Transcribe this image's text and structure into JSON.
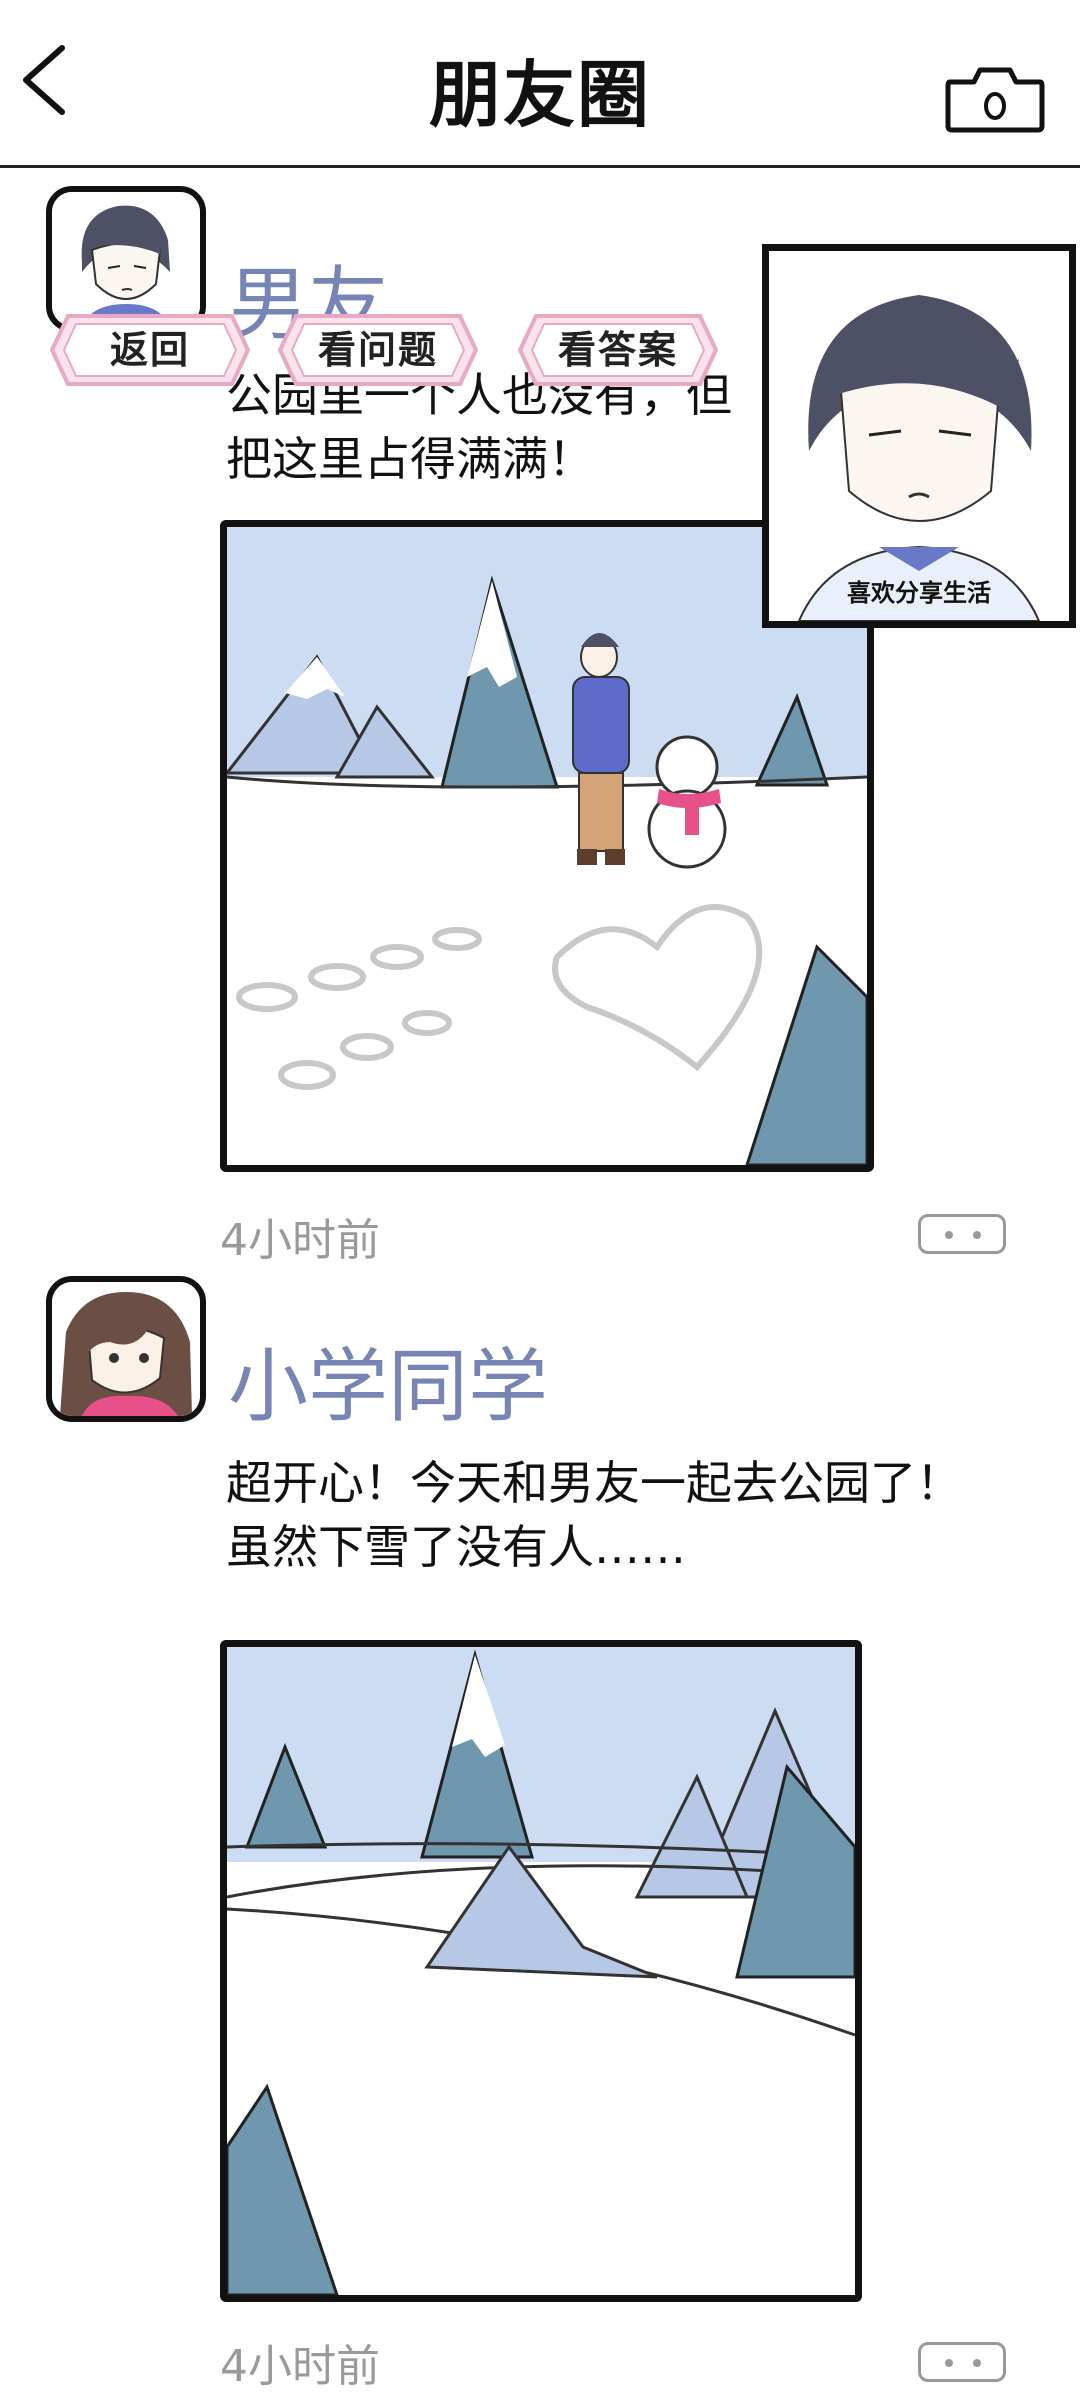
{
  "header": {
    "title": "朋友圈"
  },
  "hints": {
    "back": "返回",
    "question": "看问题",
    "answer": "看答案"
  },
  "profile_card": {
    "caption": "喜欢分享生活"
  },
  "posts": [
    {
      "name": "男友",
      "text_line1": "公园里一个人也没有，但",
      "text_line2": "把这里占得满满！",
      "time": "4小时前"
    },
    {
      "name": "小学同学",
      "text_line1": "超开心！今天和男友一起去公园了！",
      "text_line2": "虽然下雪了没有人……",
      "time": "4小时前"
    }
  ],
  "colors": {
    "name": "#7785b5",
    "hint_fill": "#fbe2ec",
    "hint_border": "#e7a9c3",
    "sky": "#cbdcf3",
    "tree": "#6f97ad"
  }
}
